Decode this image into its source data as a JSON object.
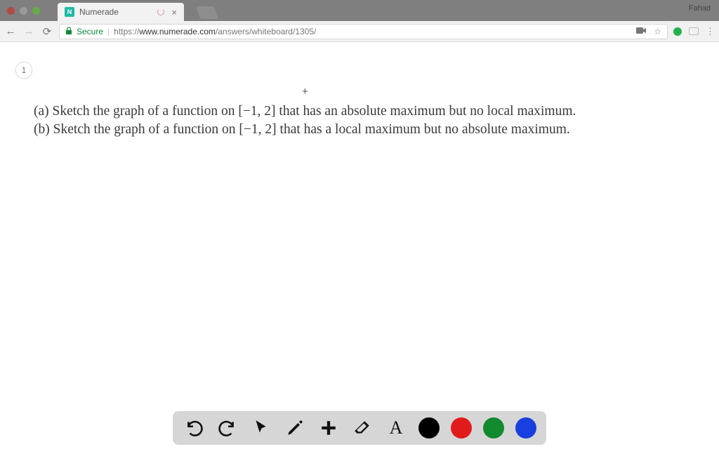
{
  "chrome": {
    "tab_title": "Numerade",
    "profile_name": "Fahad",
    "secure_label": "Secure",
    "url_scheme": "https://",
    "url_host": "www.numerade.com",
    "url_path": "/answers/whiteboard/1305/",
    "favicon_letter": "N"
  },
  "page": {
    "indicator": "1",
    "line_a": "(a) Sketch the graph of a function on [−1, 2] that has an absolute maximum but no local maximum.",
    "line_b": "(b) Sketch the graph of a function on [−1, 2] that has a local maximum but no absolute maximum.",
    "text_letter": "A"
  },
  "toolbar": {
    "colors": {
      "black": "#000000",
      "red": "#e11b1b",
      "green": "#128a2e",
      "blue": "#1a3fe0"
    }
  }
}
